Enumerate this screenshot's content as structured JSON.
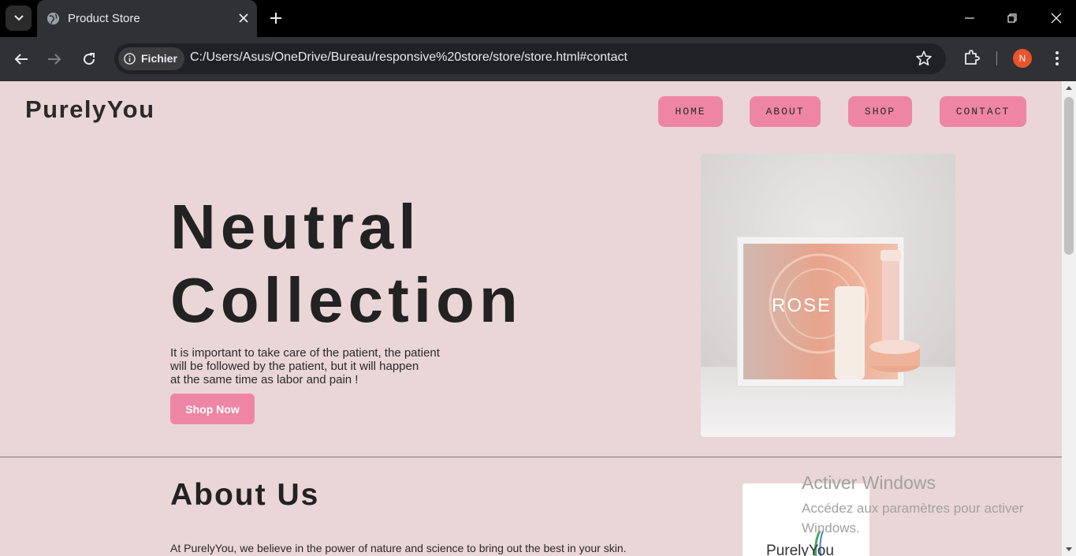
{
  "browser": {
    "tab_title": "Product Store",
    "chip_label": "Fichier",
    "url": "C:/Users/Asus/OneDrive/Bureau/responsive%20store/store/store.html#contact",
    "profile_initial": "N"
  },
  "site": {
    "logo": "PurelyYou",
    "nav": [
      "HOME",
      "ABOUT",
      "SHOP",
      "CONTACT"
    ],
    "hero": {
      "title_line1": "Neutral",
      "title_line2": "Collection",
      "text_line1": "It is important to take care of the patient, the patient",
      "text_line2": "will be followed by the patient, but it will happen",
      "text_line3": "at the same time as labor and pain !",
      "button": "Shop Now",
      "image_text": "ROSE"
    },
    "about": {
      "title": "About Us",
      "text": "At PurelyYou, we believe in the power of nature and science to bring out the best in your skin.",
      "logo_text": "PurelyYou"
    }
  },
  "watermark": {
    "line1": "Activer Windows",
    "line2": "Accédez aux paramètres pour activer",
    "line3": "Windows."
  },
  "colors": {
    "page_bg": "#ead6d6",
    "accent_pink": "#ee86a3",
    "text_dark": "#222222"
  }
}
